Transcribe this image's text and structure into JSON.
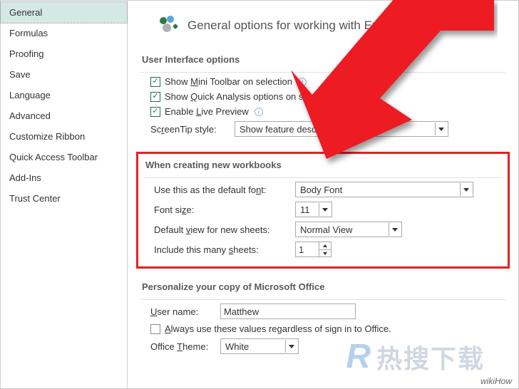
{
  "sidebar": {
    "items": [
      {
        "label": "General",
        "active": true
      },
      {
        "label": "Formulas"
      },
      {
        "label": "Proofing"
      },
      {
        "label": "Save"
      },
      {
        "label": "Language"
      },
      {
        "label": "Advanced"
      },
      {
        "label": "Customize Ribbon"
      },
      {
        "label": "Quick Access Toolbar"
      },
      {
        "label": "Add-Ins"
      },
      {
        "label": "Trust Center"
      }
    ]
  },
  "heading": "General options for working with Exce",
  "ui_section": {
    "title": "User Interface options",
    "mini_pre": "Show ",
    "mini_u": "M",
    "mini_post": "ini Toolbar on selection",
    "quick_pre": "Show ",
    "quick_u": "Q",
    "quick_post": "uick Analysis options on selection",
    "live_pre": "Enable ",
    "live_u": "L",
    "live_post": "ive Preview",
    "screentip_label_pre": "Sc",
    "screentip_label_u": "r",
    "screentip_label_post": "eenTip style:",
    "screentip_value": "Show feature description            ps"
  },
  "wb_section": {
    "title": "When creating new workbooks",
    "font_label_pre": "Use this as the default fo",
    "font_label_u": "n",
    "font_label_post": "t:",
    "font_value": "Body Font",
    "size_label_pre": "Font si",
    "size_label_u": "z",
    "size_label_post": "e:",
    "size_value": "11",
    "view_label_pre": "Default ",
    "view_label_u": "v",
    "view_label_post": "iew for new sheets:",
    "view_value": "Normal View",
    "sheets_label_pre": "Include this many ",
    "sheets_label_u": "s",
    "sheets_label_post": "heets:",
    "sheets_value": "1"
  },
  "pers_section": {
    "title": "Personalize your copy of Microsoft Office",
    "user_label_u": "U",
    "user_label_post": "ser name:",
    "user_value": "Matthew",
    "always_u": "A",
    "always_post": "lways use these values regardless of sign in to Office.",
    "theme_label_pre": "Office ",
    "theme_label_u": "T",
    "theme_label_post": "heme:",
    "theme_value": "White"
  },
  "watermark": {
    "bottom": "wikiHow",
    "cn_r": "R",
    "cn_text": "热搜下载"
  }
}
